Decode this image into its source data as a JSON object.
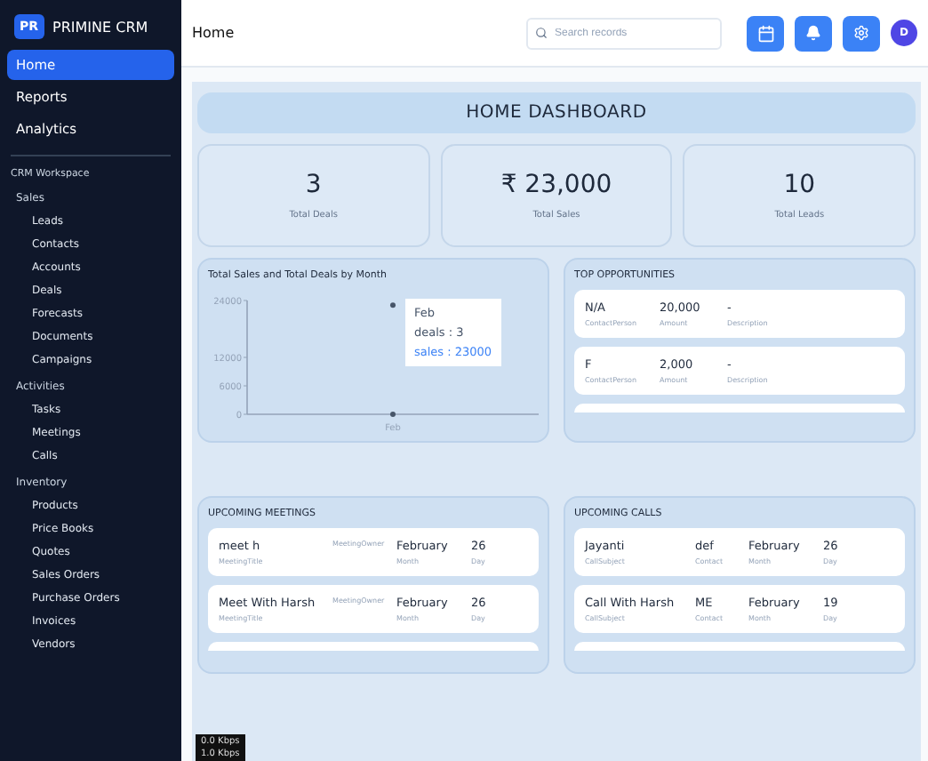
{
  "brand": {
    "badge": "PR",
    "name": "PRIMINE CRM"
  },
  "nav": [
    {
      "label": "Home",
      "selected": true
    },
    {
      "label": "Reports",
      "selected": false
    },
    {
      "label": "Analytics",
      "selected": false
    }
  ],
  "workspace": {
    "title": "CRM Workspace",
    "groups": [
      {
        "label": "Sales",
        "children": [
          "Leads",
          "Contacts",
          "Accounts",
          "Deals",
          "Forecasts",
          "Documents",
          "Campaigns"
        ]
      },
      {
        "label": "Activities",
        "children": [
          "Tasks",
          "Meetings",
          "Calls"
        ]
      },
      {
        "label": "Inventory",
        "children": [
          "Products",
          "Price Books",
          "Quotes",
          "Sales Orders",
          "Purchase Orders",
          "Invoices",
          "Vendors"
        ]
      }
    ]
  },
  "header": {
    "title": "Home",
    "search": {
      "placeholder": "Search records"
    },
    "avatar": "D"
  },
  "dashboard_title": "HOME DASHBOARD",
  "stats": [
    {
      "value": "3",
      "label": "Total Deals"
    },
    {
      "value": "₹ 23,000",
      "label": "Total Sales"
    },
    {
      "value": "10",
      "label": "Total Leads"
    }
  ],
  "chart": {
    "title": "Total Sales and Total Deals by Month",
    "tooltip_category": "Feb",
    "tooltip_values": [
      ": 3",
      ": 23000"
    ],
    "chart_data": {
      "type": "line",
      "categories": [
        "Feb"
      ],
      "yticks": [
        0,
        6000,
        12000,
        24000
      ],
      "ylim": [
        0,
        24000
      ],
      "series": [
        {
          "name": "deals",
          "color": "#475569",
          "marker": true,
          "values": [
            3
          ]
        },
        {
          "name": "sales",
          "color": "#475569",
          "marker": true,
          "values": [
            23000
          ]
        }
      ]
    }
  },
  "opportunities": {
    "title": "TOP OPPORTUNITIES",
    "items": [
      {
        "fields": [
          {
            "value": "N/A",
            "label": "ContactPerson"
          },
          {
            "value": "20,000",
            "label": "Amount"
          },
          {
            "value": "-",
            "label": "Description"
          }
        ]
      },
      {
        "fields": [
          {
            "value": "F",
            "label": "ContactPerson"
          },
          {
            "value": "2,000",
            "label": "Amount"
          },
          {
            "value": "-",
            "label": "Description"
          }
        ]
      }
    ]
  },
  "meetings": {
    "title": "UPCOMING MEETINGS",
    "items": [
      {
        "title": "meet h",
        "title_label": "MeetingTitle",
        "owner_label": "MeetingOwner",
        "month": "February",
        "month_label": "Month",
        "day": "26",
        "day_label": "Day"
      },
      {
        "title": "Meet With Harsh",
        "title_label": "MeetingTitle",
        "owner_label": "MeetingOwner",
        "month": "February",
        "month_label": "Month",
        "day": "26",
        "day_label": "Day"
      }
    ]
  },
  "calls": {
    "title": "UPCOMING CALLS",
    "items": [
      {
        "fields": [
          {
            "value": "Jayanti",
            "label": "CallSubject"
          },
          {
            "value": "def",
            "label": "Contact"
          },
          {
            "value": "February",
            "label": "Month"
          },
          {
            "value": "26",
            "label": "Day"
          }
        ]
      },
      {
        "fields": [
          {
            "value": "Call With Harsh",
            "label": "CallSubject"
          },
          {
            "value": "ME",
            "label": "Contact"
          },
          {
            "value": "February",
            "label": "Month"
          },
          {
            "value": "19",
            "label": "Day"
          }
        ]
      }
    ]
  },
  "network_overlay": [
    "0.0 Kbps",
    "1.0 Kbps"
  ]
}
